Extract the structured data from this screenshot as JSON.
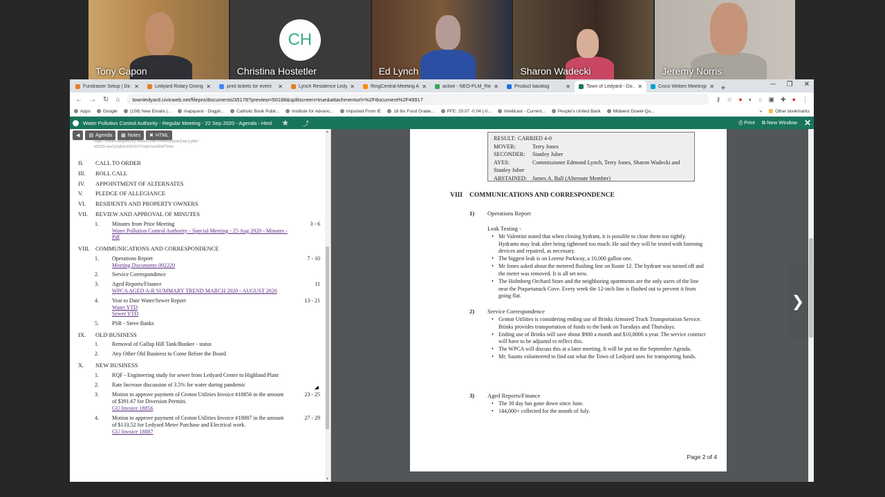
{
  "participants": [
    {
      "name": "Tony Capon"
    },
    {
      "name": "Christina Hostetler",
      "initials": "CH"
    },
    {
      "name": "Ed Lynch"
    },
    {
      "name": "Sharon Wadecki"
    },
    {
      "name": "Jeremy Norris"
    }
  ],
  "browser": {
    "tabs": [
      {
        "label": "Fundraiser Setup | Dir...",
        "color": "#e67e22"
      },
      {
        "label": "Ledyard Rotary Dining...",
        "color": "#e67e22"
      },
      {
        "label": "print tickets for event",
        "color": "#4285f4"
      },
      {
        "label": "Lynch Residence Ledy...",
        "color": "#e67e22"
      },
      {
        "label": "RingCentral Meeting A...",
        "color": "#ff8800"
      },
      {
        "label": "active - NEO-PLM_Req...",
        "color": "#34a853"
      },
      {
        "label": "Product backlog",
        "color": "#1a73e8"
      },
      {
        "label": "Town of Ledyard - Do...",
        "color": "#18755c",
        "active": true
      },
      {
        "label": "Cisco Webex Meetings",
        "color": "#00a0d1"
      }
    ],
    "new_tab": "+",
    "url": "townledyard.civicweb.net/filepro/documents/35178?preview=50188&splitscreen=true&attachmenturl=%2Fdocument%2F49917",
    "bookmarks": [
      "Apps",
      "Google",
      "(108) New Emails |...",
      "mapquest - Dogpil...",
      "Catholic Book Publi...",
      "Institute for Advanc...",
      "Imported From IE",
      "16 lbs Food Grade...",
      "PFE: 29.07 -0.04 (-0...",
      "Intellicast - Current...",
      "People's United Bank",
      "Midwest Dowel-Qu..."
    ],
    "more_bookmarks": "»",
    "other_bookmarks": "Other bookmarks"
  },
  "app_header": {
    "title": "Water Pollution Control Authority - Regular Meeting - 22 Sep 2020 - Agenda - Html",
    "print": "Print",
    "new_window": "New Window"
  },
  "left_toolbar": {
    "agenda": "Agenda",
    "notes": "Notes",
    "html": "HTML"
  },
  "cutoff_text": [
    "https://townofledyard.my.webex.com/townofledyard.my/j.php?",
    "MTID=me525ab92458165703ab15a36f4f7541e"
  ],
  "agenda": [
    {
      "num": "II.",
      "title": "CALL TO ORDER",
      "items": []
    },
    {
      "num": "III.",
      "title": "ROLL CALL",
      "items": []
    },
    {
      "num": "IV.",
      "title": "APPOINTMENT OF ALTERNATES",
      "items": []
    },
    {
      "num": "V.",
      "title": "PLEDGE OF ALLEGIANCE",
      "items": []
    },
    {
      "num": "VI.",
      "title": "RESIDENTS AND PROPERTY OWNERS",
      "items": []
    },
    {
      "num": "VII.",
      "title": "REVIEW AND APPROVAL OF MINUTES",
      "items": [
        {
          "num": "1.",
          "text": "Minutes from Prior Meeting",
          "pages": "3 - 6",
          "links": [
            "Water Pollution Control Authority - Special  Meeting - 25 Aug 2020 - Minutes - Pdf"
          ]
        }
      ]
    },
    {
      "num": "VIII.",
      "title": "COMMUNICATIONS AND CORRESPONDENCE",
      "items": [
        {
          "num": "1.",
          "text": "Operations Report",
          "pages": "7 - 10",
          "links": [
            "Meeting Documents 092220"
          ]
        },
        {
          "num": "2.",
          "text": "Service Correspondence",
          "pages": "",
          "links": []
        },
        {
          "num": "3.",
          "text": "Aged Reports/Finance",
          "pages": "11",
          "links": [
            "WPCA AGED A-R SUMMARY TREND MARCH 2020 - AUGUST 2020"
          ]
        },
        {
          "num": "4.",
          "text": "Year to Date Water/Sewer Report",
          "pages": "13 - 21",
          "links": [
            "Water YTD",
            "Sewer YTD"
          ]
        },
        {
          "num": "5.",
          "text": "PSR - Steve Banks",
          "pages": "",
          "links": []
        }
      ]
    },
    {
      "num": "IX.",
      "title": "OLD BUSINESS",
      "items": [
        {
          "num": "1.",
          "text": "Removal of Gallup Hill Tank/Bunker - status",
          "pages": "",
          "links": []
        },
        {
          "num": "2.",
          "text": "Any Other Old Business to Come Before the Board",
          "pages": "",
          "links": []
        }
      ]
    },
    {
      "num": "X.",
      "title": "NEW BUSINESS",
      "items": [
        {
          "num": "1.",
          "text": "RQF - Engineering study for sewer from Ledyard Center to Highland Plant",
          "pages": "",
          "links": []
        },
        {
          "num": "2.",
          "text": "Rate Increase discussion of 3.5% for water during pandemic",
          "pages": "",
          "links": []
        },
        {
          "num": "3.",
          "text": "Motion to approve payment of Groton Utilities Invoice #18856 in the amount of $391.67 for Diversion Permits.",
          "pages": "23 - 25",
          "links": [
            "GU Invoice 18856"
          ]
        },
        {
          "num": "4.",
          "text": "Motion to approve payment of Groton Utilities Invoice #18887 in the amount of $133.52 for Ledyard Meter Purchase and Electrical work.",
          "pages": "27 - 29",
          "links": [
            "GU Invoice 18887"
          ]
        }
      ]
    }
  ],
  "document": {
    "result_box": [
      {
        "label": "RESULT:",
        "value": "CARRIED 4-0"
      },
      {
        "label": "MOVER:",
        "value": "Terry Jones"
      },
      {
        "label": "SECONDER:",
        "value": "Stanley Juber"
      },
      {
        "label": "AYES:",
        "value": "Commissioner Edmond Lynch, Terry Jones, Sharon Wadecki and Stanley Juber"
      },
      {
        "label": "ABSTAINED:",
        "value": "James A. Ball (Alternate Member)"
      }
    ],
    "section_num": "VIII",
    "section_title": "COMMUNICATIONS AND CORRESPONDENCE",
    "s1_num": "1)",
    "s1_title": "Operations Report",
    "leak_label": "Leak Testing -",
    "s1_bullets": [
      "Mr Valentini stated that when closing hydrant, it is possible to close them too tightly. Hydrants may leak after being tightened too much. He said they will be tested with listening devices and repaired, as necessary.",
      "The biggest leak is on Lorenz Parkway, a 10,000 gallon one.",
      "Mr Jones asked about the metered flushing line on Route 12. The hydrant was turned off and the meter was removed. It is all set now.",
      "The Holmberg Orchard Store and the neighboring apartments are the only users of the line near the Poquetanuck Cove. Every week the 12-inch line is flushed out to prevent it from going flat."
    ],
    "s2_num": "2)",
    "s2_title": "Service Correspondence",
    "s2_bullets": [
      "Groton Utilities is considering ending use of Brinks Armored Truck Transportation Service. Brinks provides transportation of funds to the bank on Tuesdays and Thursdays.",
      "Ending use of Brinks will save about $900 a month and $10,8000 a year. The service contract will have to be adjusted to reflect this.",
      "The WPCA will discuss this at a later meeting. It will be put on the September Agenda.",
      "Mr. Saums volunteered to find out what the Town of Ledyard uses for transporting funds."
    ],
    "s3_num": "3)",
    "s3_title": "Aged Reports/Finance",
    "s3_bullets": [
      "The 30 day has gone down since June.",
      "144,000+ collected for the month of July."
    ],
    "page_label": "Page 2 of 4"
  }
}
